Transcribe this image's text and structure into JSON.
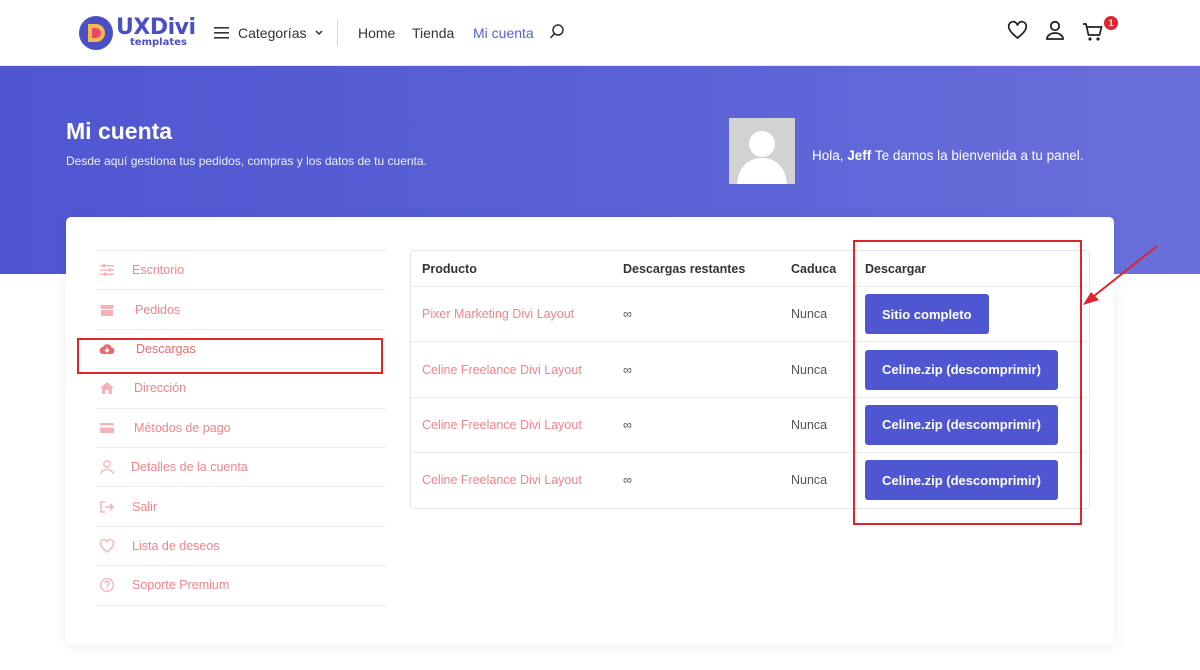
{
  "header": {
    "logo_main": "UXDivi",
    "logo_sub": "templates",
    "categories_label": "Categorías",
    "nav": [
      {
        "label": "Home"
      },
      {
        "label": "Tienda"
      },
      {
        "label": "Mi cuenta"
      }
    ],
    "cart_count": "1",
    "icons": [
      "menu-icon",
      "chevron-down-icon",
      "search-icon",
      "heart-icon",
      "user-icon",
      "cart-icon"
    ]
  },
  "hero": {
    "title": "Mi cuenta",
    "subtitle": "Desde aquí gestiona tus pedidos, compras y los datos de tu cuenta.",
    "greeting_prefix": "Hola,",
    "user_name": "Jeff",
    "greeting_suffix": "Te damos la bienvenida a tu panel."
  },
  "sidebar": {
    "items": [
      {
        "label": "Escritorio",
        "icon": "sliders-icon"
      },
      {
        "label": "Pedidos",
        "icon": "store-icon"
      },
      {
        "label": "Descargas",
        "icon": "cloud-download-icon"
      },
      {
        "label": "Dirección",
        "icon": "home-icon"
      },
      {
        "label": "Métodos de pago",
        "icon": "credit-card-icon"
      },
      {
        "label": "Detalles de la cuenta",
        "icon": "user-icon"
      },
      {
        "label": "Salir",
        "icon": "sign-out-icon"
      },
      {
        "label": "Lista de deseos",
        "icon": "heart-icon"
      },
      {
        "label": "Soporte Premium",
        "icon": "question-icon"
      }
    ],
    "active_index": 2
  },
  "downloads": {
    "headers": [
      "Producto",
      "Descargas restantes",
      "Caduca",
      "Descargar"
    ],
    "rows": [
      {
        "product": "Pixer Marketing Divi Layout",
        "remaining": "∞",
        "expires": "Nunca",
        "download": "Sitio completo"
      },
      {
        "product": "Celine Freelance Divi Layout",
        "remaining": "∞",
        "expires": "Nunca",
        "download": "Celine.zip (descomprimir)"
      },
      {
        "product": "Celine Freelance Divi Layout",
        "remaining": "∞",
        "expires": "Nunca",
        "download": "Celine.zip (descomprimir)"
      },
      {
        "product": "Celine Freelance Divi Layout",
        "remaining": "∞",
        "expires": "Nunca",
        "download": "Celine.zip (descomprimir)"
      }
    ]
  },
  "colors": {
    "brand": "#4f56d1",
    "link": "#f0848c",
    "annotation": "#e0242d"
  }
}
